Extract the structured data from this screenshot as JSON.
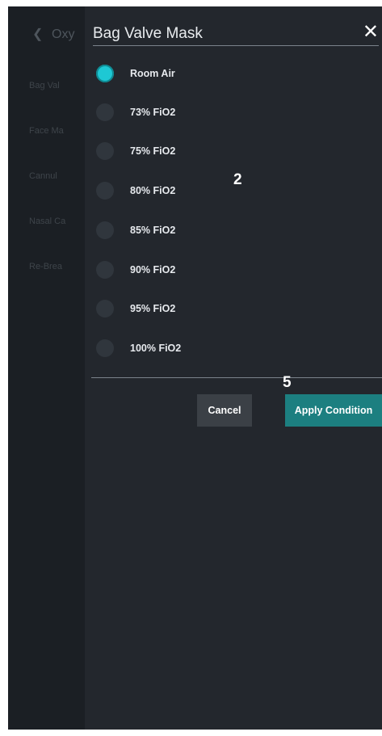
{
  "background": {
    "back_icon": "chevron-left-icon",
    "title": "Oxy",
    "items": [
      "Bag Val",
      "Face Ma",
      "Cannul",
      "Nasal Ca",
      "Re-Brea"
    ]
  },
  "modal": {
    "title": "Bag Valve Mask",
    "close_icon": "close-icon",
    "options": [
      {
        "label": "Room Air",
        "selected": true
      },
      {
        "label": "73% FiO2",
        "selected": false
      },
      {
        "label": "75% FiO2",
        "selected": false
      },
      {
        "label": "80% FiO2",
        "selected": false
      },
      {
        "label": "85% FiO2",
        "selected": false
      },
      {
        "label": "90% FiO2",
        "selected": false
      },
      {
        "label": "95% FiO2",
        "selected": false
      },
      {
        "label": "100% FiO2",
        "selected": false
      }
    ],
    "cancel_label": "Cancel",
    "apply_label": "Apply Condition"
  },
  "annotations": [
    "2",
    "5"
  ],
  "colors": {
    "accent": "#1ec8d4",
    "apply_button": "#1c7f80",
    "cancel_button": "#3b4046",
    "modal_background": "#23272d"
  }
}
